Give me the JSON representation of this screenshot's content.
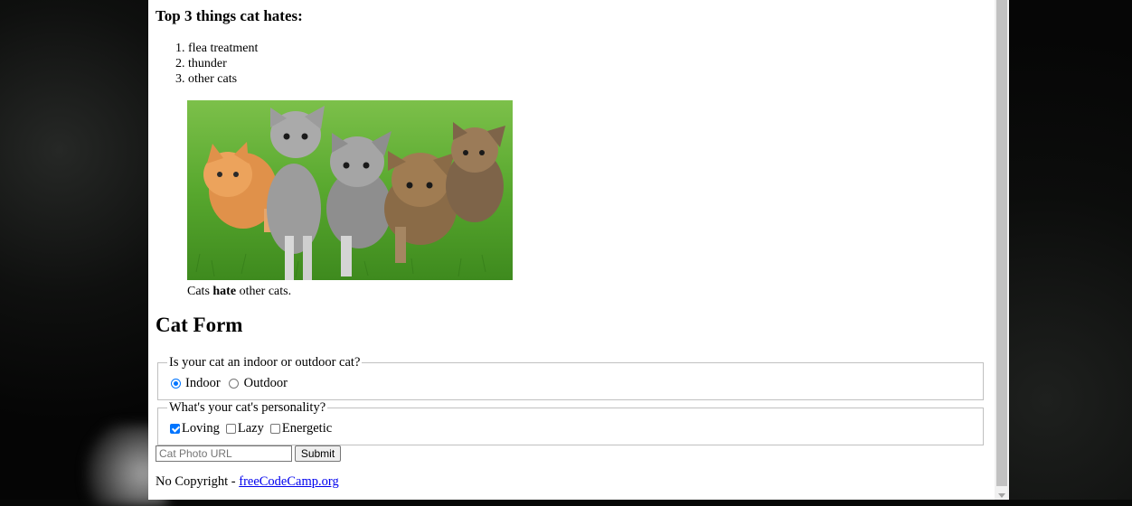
{
  "hates": {
    "heading": "Top 3 things cat hates:",
    "items": [
      "flea treatment",
      "thunder",
      "other cats"
    ]
  },
  "photo": {
    "alt": "Five cats looking around a field.",
    "caption_pre": "Cats ",
    "caption_bold": "hate",
    "caption_post": " other cats."
  },
  "form": {
    "title": "Cat Form",
    "location": {
      "legend": "Is your cat an indoor or outdoor cat?",
      "options": [
        {
          "label": "Indoor",
          "checked": true
        },
        {
          "label": "Outdoor",
          "checked": false
        }
      ]
    },
    "personality": {
      "legend": "What's your cat's personality?",
      "options": [
        {
          "label": "Loving",
          "checked": true
        },
        {
          "label": "Lazy",
          "checked": false
        },
        {
          "label": "Energetic",
          "checked": false
        }
      ]
    },
    "url_placeholder": "Cat Photo URL",
    "submit_label": "Submit"
  },
  "footer": {
    "text": "No Copyright - ",
    "link_text": "freeCodeCamp.org"
  },
  "colors": {
    "accent": "#0075ff",
    "link": "#0000ee"
  }
}
